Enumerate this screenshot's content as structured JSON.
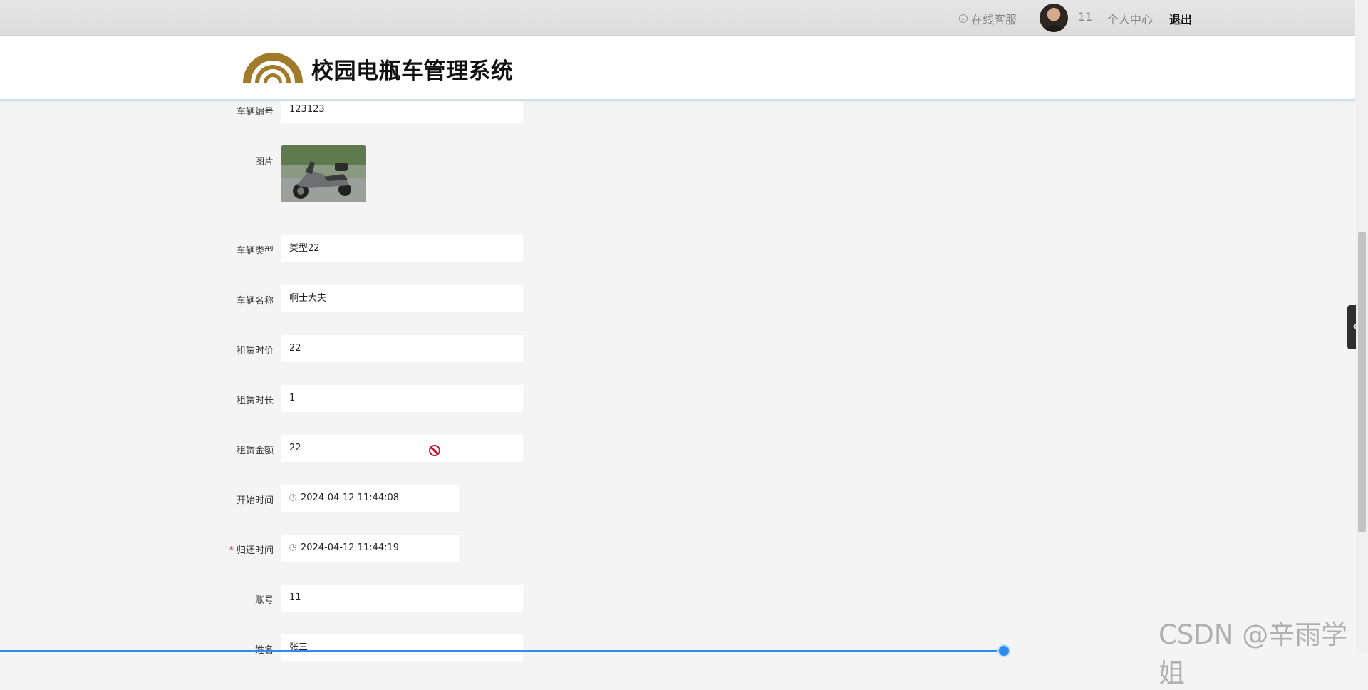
{
  "topbar": {
    "service": "在线客服",
    "username": "11",
    "personal_center": "个人中心",
    "logout": "退出"
  },
  "header": {
    "site_title": "校园电瓶车管理系统"
  },
  "form": {
    "vehicle_no": {
      "label": "车辆编号",
      "value": "123123"
    },
    "image": {
      "label": "图片"
    },
    "vehicle_type": {
      "label": "车辆类型",
      "value": "类型22"
    },
    "vehicle_name": {
      "label": "车辆名称",
      "value": "啊士大夫"
    },
    "hourly_rate": {
      "label": "租赁时价",
      "value": "22"
    },
    "duration": {
      "label": "租赁时长",
      "value": "1"
    },
    "amount": {
      "label": "租赁金额",
      "value": "22"
    },
    "start_time": {
      "label": "开始时间",
      "value": "2024-04-12 11:44:08"
    },
    "return_time": {
      "label": "归还时间",
      "value": "2024-04-12 11:44:19",
      "required_mark": "*"
    },
    "account": {
      "label": "账号",
      "value": "11"
    },
    "name": {
      "label": "姓名",
      "value": "张三"
    }
  },
  "watermark": "CSDN @辛雨学姐",
  "colors": {
    "accent": "#2d8cf0",
    "logo_gold": "#a07b2a",
    "danger": "#c8102e"
  }
}
